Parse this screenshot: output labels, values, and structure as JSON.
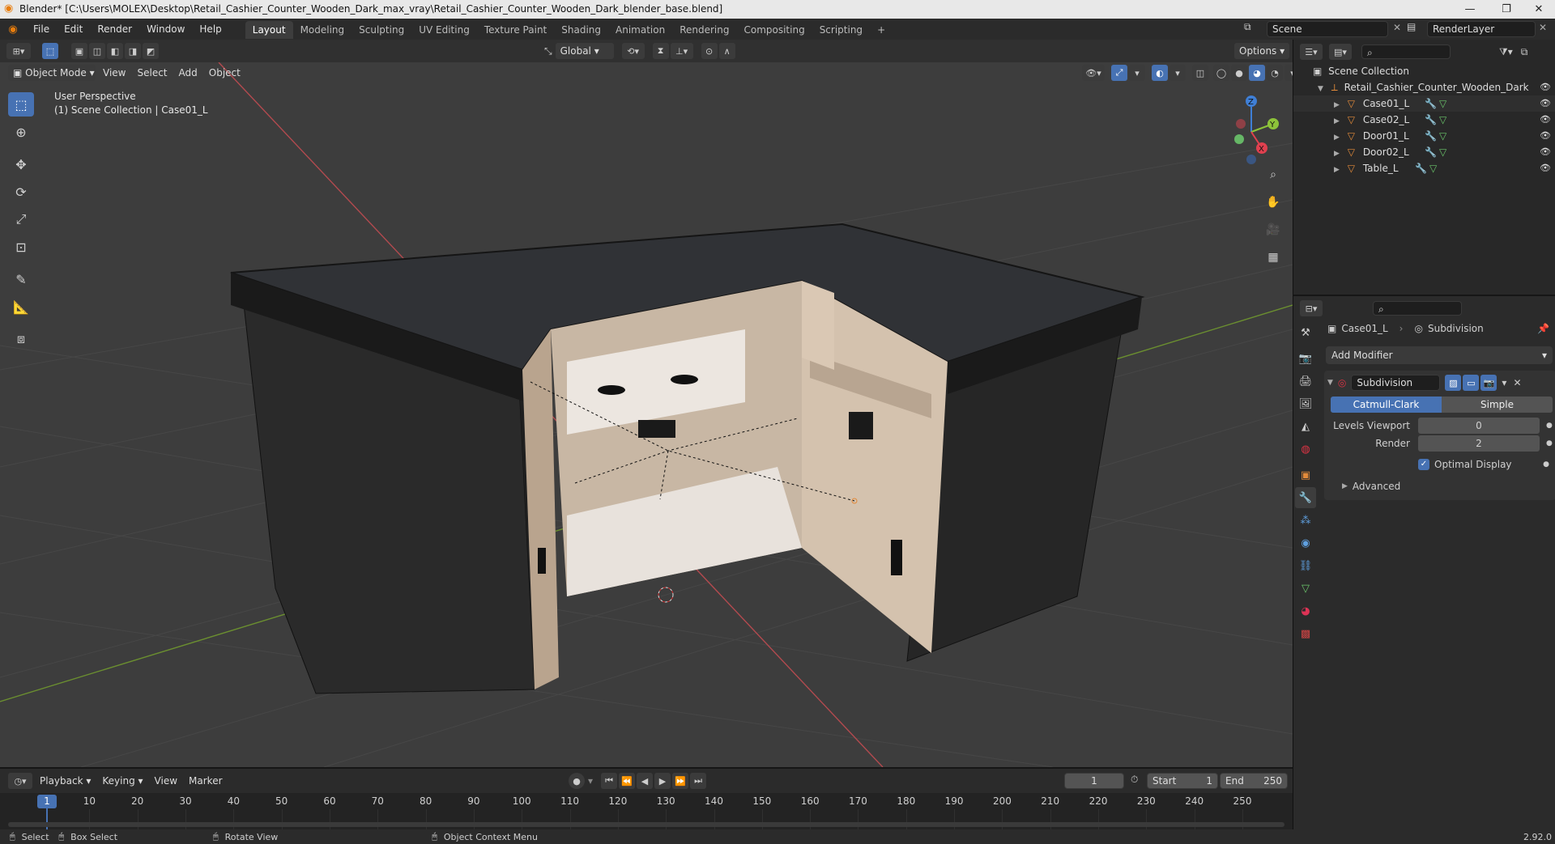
{
  "titlebar": {
    "title": "Blender* [C:\\Users\\MOLEX\\Desktop\\Retail_Cashier_Counter_Wooden_Dark_max_vray\\Retail_Cashier_Counter_Wooden_Dark_blender_base.blend]",
    "minimize": "—",
    "restore": "❐",
    "close": "✕"
  },
  "menu": [
    "File",
    "Edit",
    "Render",
    "Window",
    "Help"
  ],
  "workspaces": [
    "Layout",
    "Modeling",
    "Sculpting",
    "UV Editing",
    "Texture Paint",
    "Shading",
    "Animation",
    "Rendering",
    "Compositing",
    "Scripting",
    "+"
  ],
  "active_workspace": "Layout",
  "scene": {
    "name": "Scene",
    "view_layer": "RenderLayer"
  },
  "viewport_header": {
    "transform_orientation": "Global",
    "options": "Options",
    "mode": "Object Mode",
    "menus": [
      "View",
      "Select",
      "Add",
      "Object"
    ]
  },
  "viewport": {
    "perspective": "User Perspective",
    "collection_info": "(1) Scene Collection | Case01_L",
    "gizmo": {
      "z": "Z",
      "y": "Y",
      "x": "X"
    }
  },
  "outliner": {
    "root": "Scene Collection",
    "collection": "Retail_Cashier_Counter_Wooden_Dark",
    "objects": [
      "Case01_L",
      "Case02_L",
      "Door01_L",
      "Door02_L",
      "Table_L"
    ]
  },
  "properties": {
    "object": "Case01_L",
    "modifier_tab": "Subdivision",
    "add_modifier": "Add Modifier",
    "modifier_name": "Subdivision",
    "type_options": [
      "Catmull-Clark",
      "Simple"
    ],
    "active_type": "Catmull-Clark",
    "levels_viewport_label": "Levels Viewport",
    "levels_viewport": "0",
    "render_label": "Render",
    "render": "2",
    "optimal_display_label": "Optimal Display",
    "optimal_display": true,
    "advanced": "Advanced"
  },
  "timeline": {
    "menus": [
      "Playback",
      "Keying",
      "View",
      "Marker"
    ],
    "current_frame": "1",
    "start_label": "Start",
    "start": "1",
    "end_label": "End",
    "end": "250",
    "ticks": [
      "1",
      "10",
      "20",
      "30",
      "40",
      "50",
      "60",
      "70",
      "80",
      "90",
      "100",
      "110",
      "120",
      "130",
      "140",
      "150",
      "160",
      "170",
      "180",
      "190",
      "200",
      "210",
      "220",
      "230",
      "240",
      "250"
    ]
  },
  "statusbar": {
    "items": [
      "Select",
      "Box Select",
      "Rotate View",
      "Object Context Menu"
    ],
    "version": "2.92.0"
  },
  "colors": {
    "accent": "#4772b3",
    "object_orange": "#e28a3a",
    "mesh_green": "#6ac46a",
    "x_axis": "#e0404f",
    "y_axis": "#8dc33a",
    "z_axis": "#3f7fd6"
  }
}
